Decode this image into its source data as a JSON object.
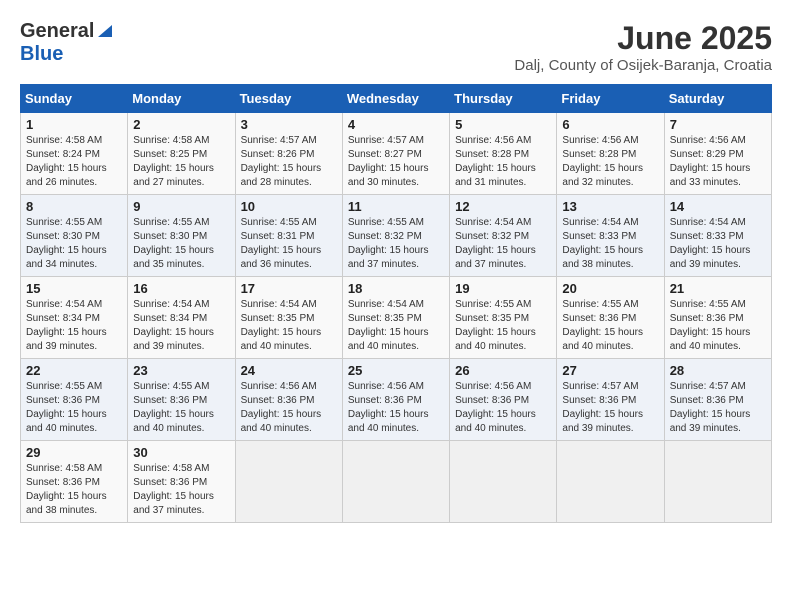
{
  "logo": {
    "general": "General",
    "blue": "Blue"
  },
  "title": {
    "month_year": "June 2025",
    "location": "Dalj, County of Osijek-Baranja, Croatia"
  },
  "calendar": {
    "headers": [
      "Sunday",
      "Monday",
      "Tuesday",
      "Wednesday",
      "Thursday",
      "Friday",
      "Saturday"
    ],
    "weeks": [
      [
        {
          "day": "",
          "info": ""
        },
        {
          "day": "2",
          "info": "Sunrise: 4:58 AM\nSunset: 8:25 PM\nDaylight: 15 hours\nand 27 minutes."
        },
        {
          "day": "3",
          "info": "Sunrise: 4:57 AM\nSunset: 8:26 PM\nDaylight: 15 hours\nand 28 minutes."
        },
        {
          "day": "4",
          "info": "Sunrise: 4:57 AM\nSunset: 8:27 PM\nDaylight: 15 hours\nand 30 minutes."
        },
        {
          "day": "5",
          "info": "Sunrise: 4:56 AM\nSunset: 8:28 PM\nDaylight: 15 hours\nand 31 minutes."
        },
        {
          "day": "6",
          "info": "Sunrise: 4:56 AM\nSunset: 8:28 PM\nDaylight: 15 hours\nand 32 minutes."
        },
        {
          "day": "7",
          "info": "Sunrise: 4:56 AM\nSunset: 8:29 PM\nDaylight: 15 hours\nand 33 minutes."
        }
      ],
      [
        {
          "day": "8",
          "info": "Sunrise: 4:55 AM\nSunset: 8:30 PM\nDaylight: 15 hours\nand 34 minutes."
        },
        {
          "day": "9",
          "info": "Sunrise: 4:55 AM\nSunset: 8:30 PM\nDaylight: 15 hours\nand 35 minutes."
        },
        {
          "day": "10",
          "info": "Sunrise: 4:55 AM\nSunset: 8:31 PM\nDaylight: 15 hours\nand 36 minutes."
        },
        {
          "day": "11",
          "info": "Sunrise: 4:55 AM\nSunset: 8:32 PM\nDaylight: 15 hours\nand 37 minutes."
        },
        {
          "day": "12",
          "info": "Sunrise: 4:54 AM\nSunset: 8:32 PM\nDaylight: 15 hours\nand 37 minutes."
        },
        {
          "day": "13",
          "info": "Sunrise: 4:54 AM\nSunset: 8:33 PM\nDaylight: 15 hours\nand 38 minutes."
        },
        {
          "day": "14",
          "info": "Sunrise: 4:54 AM\nSunset: 8:33 PM\nDaylight: 15 hours\nand 39 minutes."
        }
      ],
      [
        {
          "day": "15",
          "info": "Sunrise: 4:54 AM\nSunset: 8:34 PM\nDaylight: 15 hours\nand 39 minutes."
        },
        {
          "day": "16",
          "info": "Sunrise: 4:54 AM\nSunset: 8:34 PM\nDaylight: 15 hours\nand 39 minutes."
        },
        {
          "day": "17",
          "info": "Sunrise: 4:54 AM\nSunset: 8:35 PM\nDaylight: 15 hours\nand 40 minutes."
        },
        {
          "day": "18",
          "info": "Sunrise: 4:54 AM\nSunset: 8:35 PM\nDaylight: 15 hours\nand 40 minutes."
        },
        {
          "day": "19",
          "info": "Sunrise: 4:55 AM\nSunset: 8:35 PM\nDaylight: 15 hours\nand 40 minutes."
        },
        {
          "day": "20",
          "info": "Sunrise: 4:55 AM\nSunset: 8:36 PM\nDaylight: 15 hours\nand 40 minutes."
        },
        {
          "day": "21",
          "info": "Sunrise: 4:55 AM\nSunset: 8:36 PM\nDaylight: 15 hours\nand 40 minutes."
        }
      ],
      [
        {
          "day": "22",
          "info": "Sunrise: 4:55 AM\nSunset: 8:36 PM\nDaylight: 15 hours\nand 40 minutes."
        },
        {
          "day": "23",
          "info": "Sunrise: 4:55 AM\nSunset: 8:36 PM\nDaylight: 15 hours\nand 40 minutes."
        },
        {
          "day": "24",
          "info": "Sunrise: 4:56 AM\nSunset: 8:36 PM\nDaylight: 15 hours\nand 40 minutes."
        },
        {
          "day": "25",
          "info": "Sunrise: 4:56 AM\nSunset: 8:36 PM\nDaylight: 15 hours\nand 40 minutes."
        },
        {
          "day": "26",
          "info": "Sunrise: 4:56 AM\nSunset: 8:36 PM\nDaylight: 15 hours\nand 40 minutes."
        },
        {
          "day": "27",
          "info": "Sunrise: 4:57 AM\nSunset: 8:36 PM\nDaylight: 15 hours\nand 39 minutes."
        },
        {
          "day": "28",
          "info": "Sunrise: 4:57 AM\nSunset: 8:36 PM\nDaylight: 15 hours\nand 39 minutes."
        }
      ],
      [
        {
          "day": "29",
          "info": "Sunrise: 4:58 AM\nSunset: 8:36 PM\nDaylight: 15 hours\nand 38 minutes."
        },
        {
          "day": "30",
          "info": "Sunrise: 4:58 AM\nSunset: 8:36 PM\nDaylight: 15 hours\nand 37 minutes."
        },
        {
          "day": "",
          "info": ""
        },
        {
          "day": "",
          "info": ""
        },
        {
          "day": "",
          "info": ""
        },
        {
          "day": "",
          "info": ""
        },
        {
          "day": "",
          "info": ""
        }
      ]
    ],
    "week0_day1": {
      "day": "1",
      "info": "Sunrise: 4:58 AM\nSunset: 8:24 PM\nDaylight: 15 hours\nand 26 minutes."
    }
  }
}
